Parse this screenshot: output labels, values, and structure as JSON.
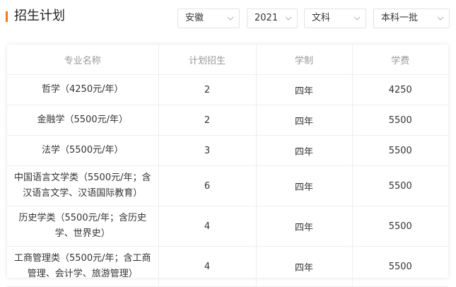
{
  "section": {
    "title": "招生计划"
  },
  "filters": [
    {
      "value": "安徽"
    },
    {
      "value": "2021"
    },
    {
      "value": "文科"
    },
    {
      "value": "本科一批"
    }
  ],
  "table": {
    "headers": [
      "专业名称",
      "计划招生",
      "学制",
      "学费"
    ],
    "rows": [
      {
        "name": "哲学（4250元/年）",
        "plan": "2",
        "duration": "四年",
        "fee": "4250"
      },
      {
        "name": "金融学（5500元/年）",
        "plan": "2",
        "duration": "四年",
        "fee": "5500"
      },
      {
        "name": "法学（5500元/年）",
        "plan": "3",
        "duration": "四年",
        "fee": "5500"
      },
      {
        "name": "中国语言文学类（5500元/年；含汉语言文学、汉语国际教育）",
        "plan": "6",
        "duration": "四年",
        "fee": "5500"
      },
      {
        "name": "历史学类（5500元/年；含历史学、世界史）",
        "plan": "4",
        "duration": "四年",
        "fee": "5500"
      },
      {
        "name": "工商管理类（5500元/年；含工商管理、会计学、旅游管理）",
        "plan": "4",
        "duration": "四年",
        "fee": "5500"
      }
    ]
  }
}
